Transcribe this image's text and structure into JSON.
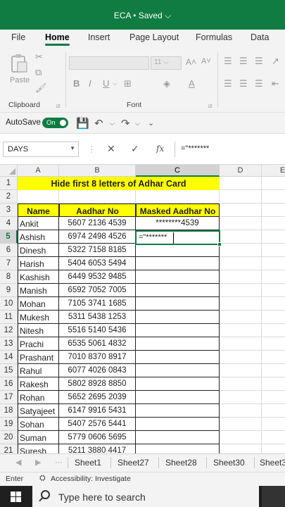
{
  "app": {
    "title": "ECA • Saved",
    "title_chevron": "⌵"
  },
  "menu": {
    "tabs": [
      "File",
      "Home",
      "Insert",
      "Page Layout",
      "Formulas",
      "Data"
    ]
  },
  "ribbon": {
    "paste_label": "Paste",
    "clipboard_label": "Clipboard",
    "font_label": "Font",
    "font_size": "11",
    "bold": "B",
    "italic": "I",
    "underline": "U"
  },
  "autosave": {
    "label": "AutoSave",
    "state": "On"
  },
  "formula_bar": {
    "name_box": "DAYS",
    "formula": "=\"*******",
    "cancel": "✕",
    "enter": "✓",
    "fx": "fx"
  },
  "columns": [
    "A",
    "B",
    "C",
    "D",
    "E"
  ],
  "rows": [
    "1",
    "2",
    "3",
    "4",
    "5",
    "6",
    "7",
    "8",
    "9",
    "10",
    "11",
    "12",
    "13",
    "14",
    "15",
    "16",
    "17",
    "18",
    "19",
    "20",
    "21"
  ],
  "sheet": {
    "title": "Hide first 8 letters of Adhar Card",
    "headers": {
      "name": "Name",
      "aadhar": "Aadhar No",
      "masked": "Masked Aadhar No"
    },
    "records": [
      {
        "name": "Ankit",
        "aadhar": "5607 2136 4539",
        "masked": "********4539"
      },
      {
        "name": "Ashish",
        "aadhar": "6974 2498 4526",
        "masked": ""
      },
      {
        "name": "Dinesh",
        "aadhar": "5322 7158 8185",
        "masked": ""
      },
      {
        "name": "Harish",
        "aadhar": "5404 6053 5494",
        "masked": ""
      },
      {
        "name": "Kashish",
        "aadhar": "6449 9532 9485",
        "masked": ""
      },
      {
        "name": "Manish",
        "aadhar": "6592 7052 7005",
        "masked": ""
      },
      {
        "name": "Mohan",
        "aadhar": "7105 3741 1685",
        "masked": ""
      },
      {
        "name": "Mukesh",
        "aadhar": "5311 5438 1253",
        "masked": ""
      },
      {
        "name": "Nitesh",
        "aadhar": "5516 5140 5436",
        "masked": ""
      },
      {
        "name": "Prachi",
        "aadhar": "6535 5061 4832",
        "masked": ""
      },
      {
        "name": "Prashant",
        "aadhar": "7010 8370 8917",
        "masked": ""
      },
      {
        "name": "Rahul",
        "aadhar": "6077 4026 0843",
        "masked": ""
      },
      {
        "name": "Rakesh",
        "aadhar": "5802 8928 8850",
        "masked": ""
      },
      {
        "name": "Rohan",
        "aadhar": "5652 2695 2039",
        "masked": ""
      },
      {
        "name": "Satyajeet",
        "aadhar": "6147 9916 5431",
        "masked": ""
      },
      {
        "name": "Sohan",
        "aadhar": "5407 2576 5441",
        "masked": ""
      },
      {
        "name": "Suman",
        "aadhar": "5779 0606 5695",
        "masked": ""
      },
      {
        "name": "Suresh",
        "aadhar": "5211 3880 4417",
        "masked": ""
      }
    ],
    "active_cell_text": "=\"*******"
  },
  "sheet_tabs": [
    "Sheet1",
    "Sheet27",
    "Sheet28",
    "Sheet30",
    "Sheet3"
  ],
  "status": {
    "mode": "Enter",
    "accessibility": "Accessibility: Investigate"
  },
  "taskbar": {
    "search_placeholder": "Type here to search"
  }
}
